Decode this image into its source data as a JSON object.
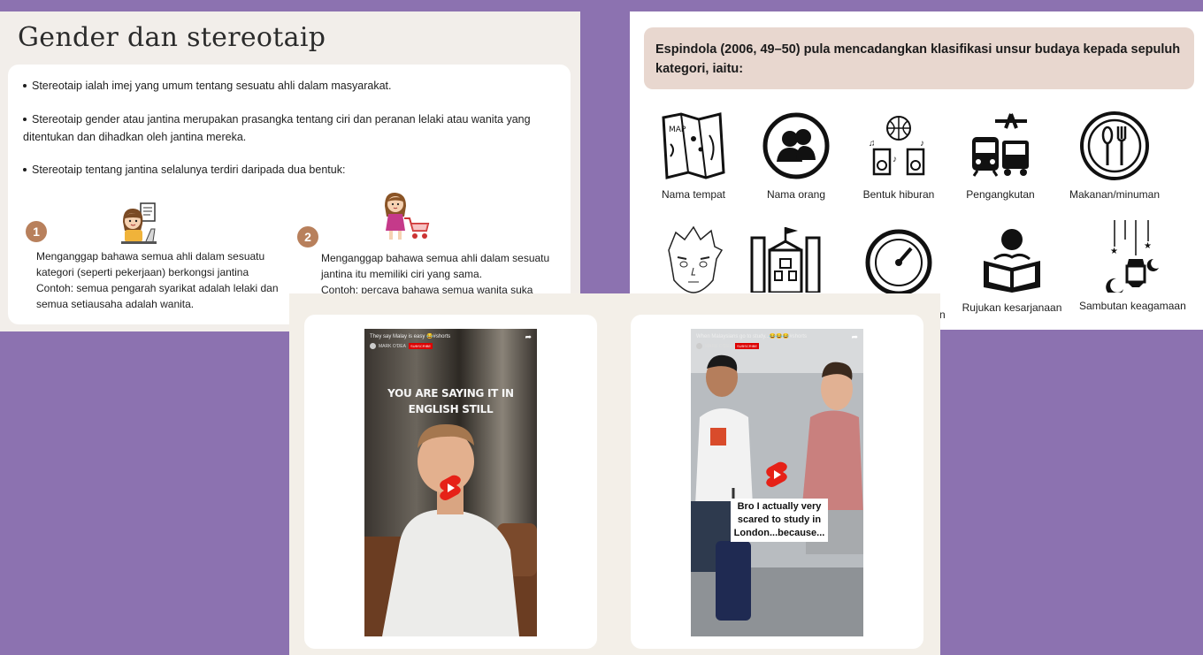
{
  "slide1": {
    "title": "Gender dan stereotaip",
    "bullets": [
      "Stereotaip ialah imej yang umum tentang sesuatu ahli dalam masyarakat.",
      "Stereotaip gender atau jantina merupakan prasangka tentang ciri dan peranan lelaki atau wanita yang ditentukan dan dihadkan oleh jantina mereka.",
      "Stereotaip tentang jantina selalunya terdiri daripada dua bentuk:"
    ],
    "forms": [
      {
        "num": "1",
        "text": "Menganggap bahawa semua ahli dalam sesuatu kategori (seperti pekerjaan) berkongsi jantina",
        "example": "Contoh: semua pengarah syarikat adalah lelaki dan semua setiausaha adalah wanita."
      },
      {
        "num": "2",
        "text": "Menganggap bahawa semua ahli dalam sesuatu jantina itu memiliki ciri yang sama.",
        "example": "Contoh: percaya bahawa semua wanita suka"
      }
    ]
  },
  "slide2": {
    "banner": "Espindola (2006, 49–50) pula mencadangkan klasifikasi unsur budaya kepada sepuluh kategori, iaitu:",
    "categories": [
      {
        "label": "Nama tempat",
        "icon": "map-icon"
      },
      {
        "label": "Nama orang",
        "icon": "people-icon"
      },
      {
        "label": "Bentuk hiburan",
        "icon": "entertainment-icon"
      },
      {
        "label": "Pengangkutan",
        "icon": "transport-icon"
      },
      {
        "label": "Makanan/minuman",
        "icon": "food-icon"
      },
      {
        "label": "",
        "icon": "anime-face-icon"
      },
      {
        "label": "",
        "icon": "building-icon"
      },
      {
        "label": "n",
        "icon": "gauge-icon"
      },
      {
        "label": "Rujukan kesarjanaan",
        "icon": "reading-icon"
      },
      {
        "label": "Sambutan keagamaan",
        "icon": "lantern-icon"
      }
    ]
  },
  "slide3": {
    "videos": [
      {
        "title": "They say Malay is easy 😂#shorts",
        "channel": "MARK O'DEA",
        "subscribe": "SUBSCRIBE",
        "caption": "YOU ARE SAYING IT IN ENGLISH STILL"
      },
      {
        "title": "When Malaysians go to study...😂😂😂#shorts",
        "channel": "MARK O'DEA",
        "subscribe": "SUBSCRIBE",
        "caption": "Bro I actually very scared to study in London...because..."
      }
    ]
  },
  "colors": {
    "background": "#8c72b0",
    "accent_number": "#b8805c",
    "banner": "#e8d7cf",
    "youtube_red": "#e62117"
  }
}
